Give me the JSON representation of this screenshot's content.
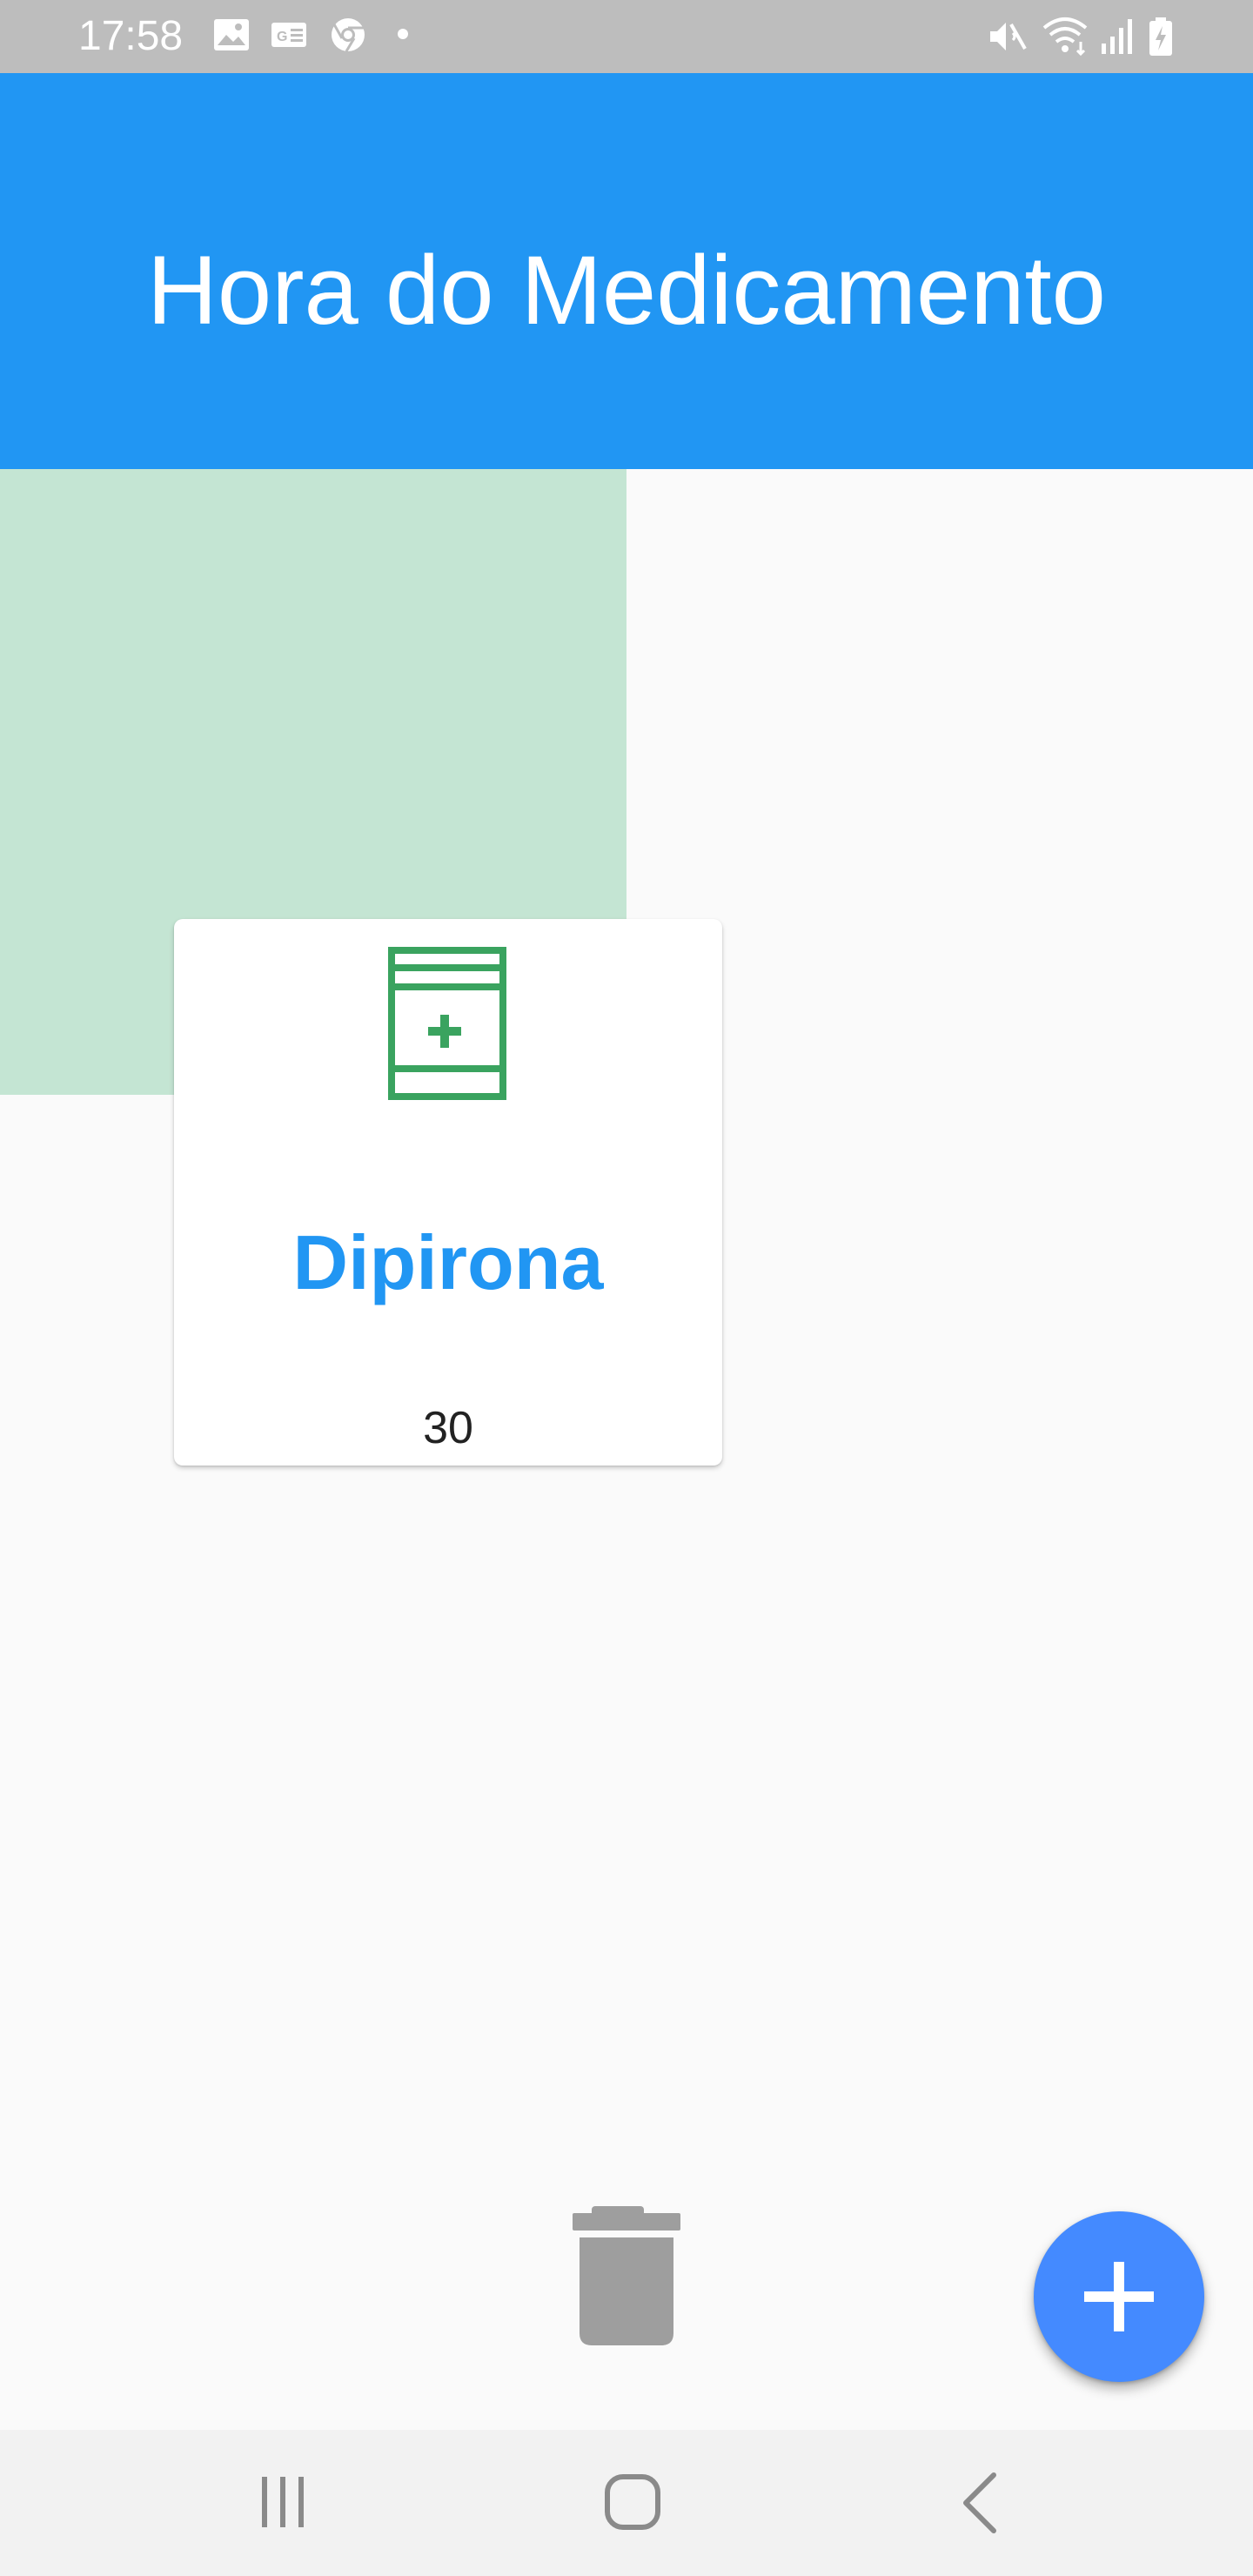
{
  "status_bar": {
    "time": "17:58",
    "left_icons": [
      "gallery-icon",
      "news-icon",
      "chrome-icon",
      "dot-icon"
    ],
    "right_icons": [
      "mute-icon",
      "wifi-icon",
      "signal-icon",
      "battery-charging-icon"
    ]
  },
  "app_bar": {
    "title": "Hora do Medicamento",
    "color": "#2196f3"
  },
  "panel": {
    "color": "#c4e5d3"
  },
  "medication_card": {
    "icon": "medicine-bottle-icon",
    "icon_color": "#3aa35f",
    "name": "Dipirona",
    "name_color": "#2196f3",
    "quantity": "30"
  },
  "actions": {
    "delete_icon": "trash-icon",
    "add_icon": "plus-icon",
    "fab_color": "#448aff"
  },
  "nav_bar": {
    "items": [
      "recents-icon",
      "home-icon",
      "back-icon"
    ]
  }
}
